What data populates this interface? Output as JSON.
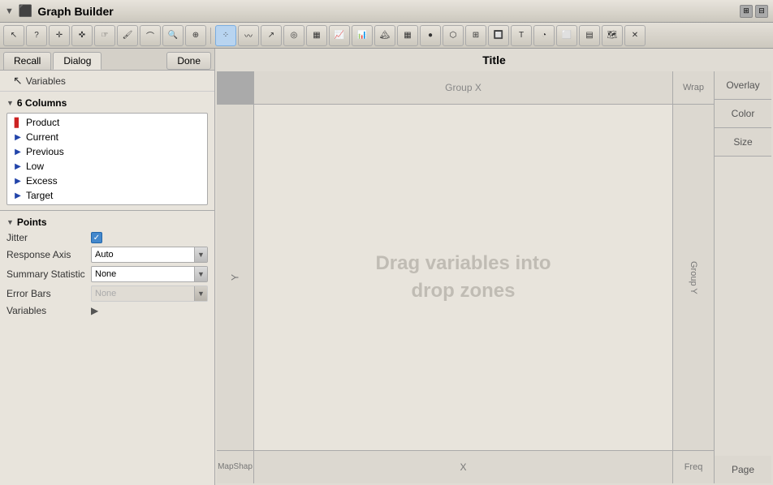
{
  "titleBar": {
    "title": "Graph Builder",
    "icon": "▼"
  },
  "tabs": {
    "recall": "Recall",
    "dialog": "Dialog",
    "done": "Done"
  },
  "leftPanel": {
    "variables_label": "Variables",
    "columns": {
      "header": "6 Columns",
      "items": [
        {
          "name": "Product",
          "iconType": "bar",
          "iconColor": "red"
        },
        {
          "name": "Current",
          "iconType": "triangle",
          "iconColor": "blue"
        },
        {
          "name": "Previous",
          "iconType": "triangle",
          "iconColor": "blue"
        },
        {
          "name": "Low",
          "iconType": "triangle",
          "iconColor": "blue"
        },
        {
          "name": "Excess",
          "iconType": "triangle",
          "iconColor": "blue"
        },
        {
          "name": "Target",
          "iconType": "triangle",
          "iconColor": "blue"
        }
      ]
    },
    "points": {
      "header": "Points",
      "fields": {
        "jitter": {
          "label": "Jitter",
          "checked": true
        },
        "responseAxis": {
          "label": "Response Axis",
          "value": "Auto"
        },
        "summaryStatistic": {
          "label": "Summary Statistic",
          "value": "None"
        },
        "errorBars": {
          "label": "Error Bars",
          "value": "None"
        },
        "variables": {
          "label": "Variables"
        }
      }
    }
  },
  "canvas": {
    "title": "Title",
    "groupX": "Group X",
    "wrap": "Wrap",
    "overlay": "Overlay",
    "y": "Y",
    "groupY": "Group Y",
    "color": "Color",
    "size": "Size",
    "dropText1": "Drag variables into",
    "dropText2": "drop zones",
    "mapShap": "Map\nShap",
    "x": "X",
    "freq": "Freq",
    "page": "Page"
  },
  "toolbar": {
    "icons": [
      "🔷",
      "〰",
      "⋯",
      "◎",
      "■",
      "📈",
      "📊",
      "🗻",
      "🔲",
      "🔺",
      "🔵",
      "⬛",
      "🔳",
      "📋",
      "◐",
      "🔲",
      "🔲",
      "🔘",
      "🔶",
      "🗺"
    ]
  }
}
